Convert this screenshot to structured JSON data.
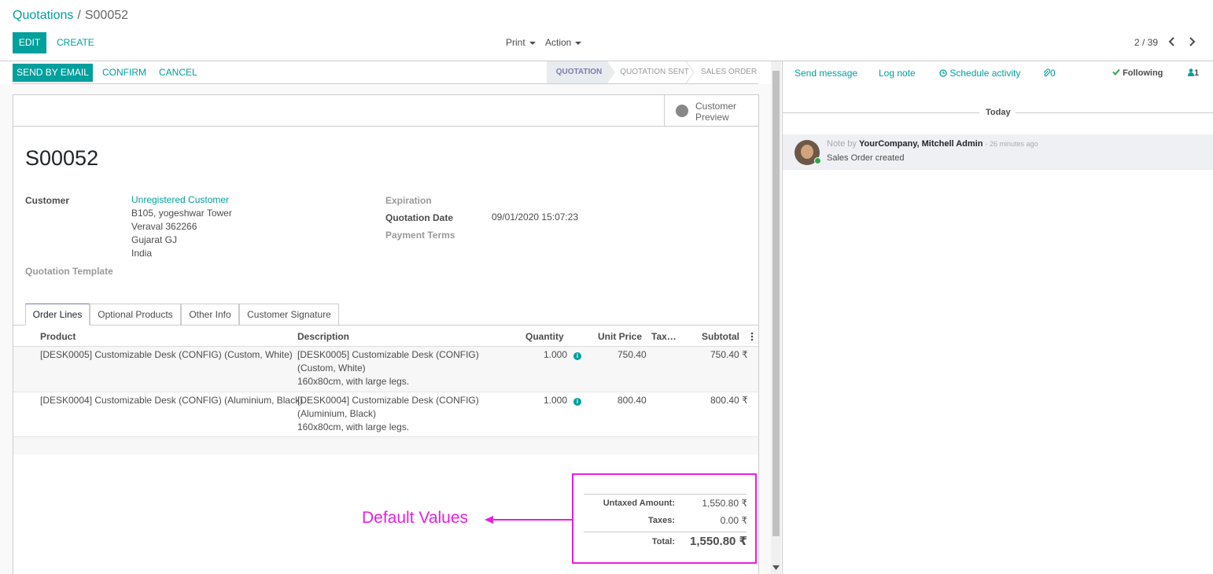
{
  "breadcrumb": {
    "parent": "Quotations",
    "separator": "/",
    "current": "S00052"
  },
  "toolbar": {
    "edit_label": "EDIT",
    "create_label": "CREATE",
    "print_label": "Print",
    "action_label": "Action"
  },
  "pager": {
    "value": "2 / 39"
  },
  "statusbar": {
    "send_email": "SEND BY EMAIL",
    "confirm": "CONFIRM",
    "cancel": "CANCEL",
    "stages": [
      "QUOTATION",
      "QUOTATION SENT",
      "SALES ORDER"
    ],
    "active_stage": "QUOTATION"
  },
  "stat_button": {
    "line1": "Customer",
    "line2": "Preview",
    "icon": "globe-icon"
  },
  "record": {
    "name": "S00052",
    "customer_label": "Customer",
    "customer_name": "Unregistered Customer",
    "address": [
      "B105, yogeshwar Tower",
      "Veraval 362266",
      "Gujarat GJ",
      "India"
    ],
    "quotation_template_label": "Quotation Template",
    "expiration_label": "Expiration",
    "quotation_date_label": "Quotation Date",
    "quotation_date": "09/01/2020 15:07:23",
    "payment_terms_label": "Payment Terms"
  },
  "tabs": [
    "Order Lines",
    "Optional Products",
    "Other Info",
    "Customer Signature"
  ],
  "table": {
    "headers": {
      "product": "Product",
      "description": "Description",
      "quantity": "Quantity",
      "unit_price": "Unit Price",
      "taxes": "Tax…",
      "subtotal": "Subtotal"
    },
    "rows": [
      {
        "product": "[DESK0005] Customizable Desk (CONFIG) (Custom, White)",
        "description": [
          "[DESK0005] Customizable Desk (CONFIG)",
          "(Custom, White)",
          "160x80cm, with large legs."
        ],
        "quantity": "1.000",
        "unit_price": "750.40",
        "subtotal": "750.40 ₹"
      },
      {
        "product": "[DESK0004] Customizable Desk (CONFIG) (Aluminium, Black)",
        "description": [
          "[DESK0004] Customizable Desk (CONFIG)",
          "(Aluminium, Black)",
          "160x80cm, with large legs."
        ],
        "quantity": "1.000",
        "unit_price": "800.40",
        "subtotal": "800.40 ₹"
      }
    ]
  },
  "totals": {
    "untaxed_label": "Untaxed Amount:",
    "untaxed_value": "1,550.80 ₹",
    "taxes_label": "Taxes:",
    "taxes_value": "0.00 ₹",
    "total_label": "Total:",
    "total_value": "1,550.80 ₹"
  },
  "annotation": {
    "text": "Default Values",
    "color": "#e91ee0"
  },
  "chatter": {
    "send_message": "Send message",
    "log_note": "Log note",
    "schedule_activity": "Schedule activity",
    "attachments_count": "0",
    "following": "Following",
    "followers_count": "1",
    "today": "Today",
    "message": {
      "prefix": "Note by",
      "author": "YourCompany, Mitchell Admin",
      "time": "- 26 minutes ago",
      "body": "Sales Order created"
    }
  },
  "colors": {
    "accent": "#00A09D",
    "stage_active": "#7C7BAD",
    "highlight": "#e91ee0"
  }
}
